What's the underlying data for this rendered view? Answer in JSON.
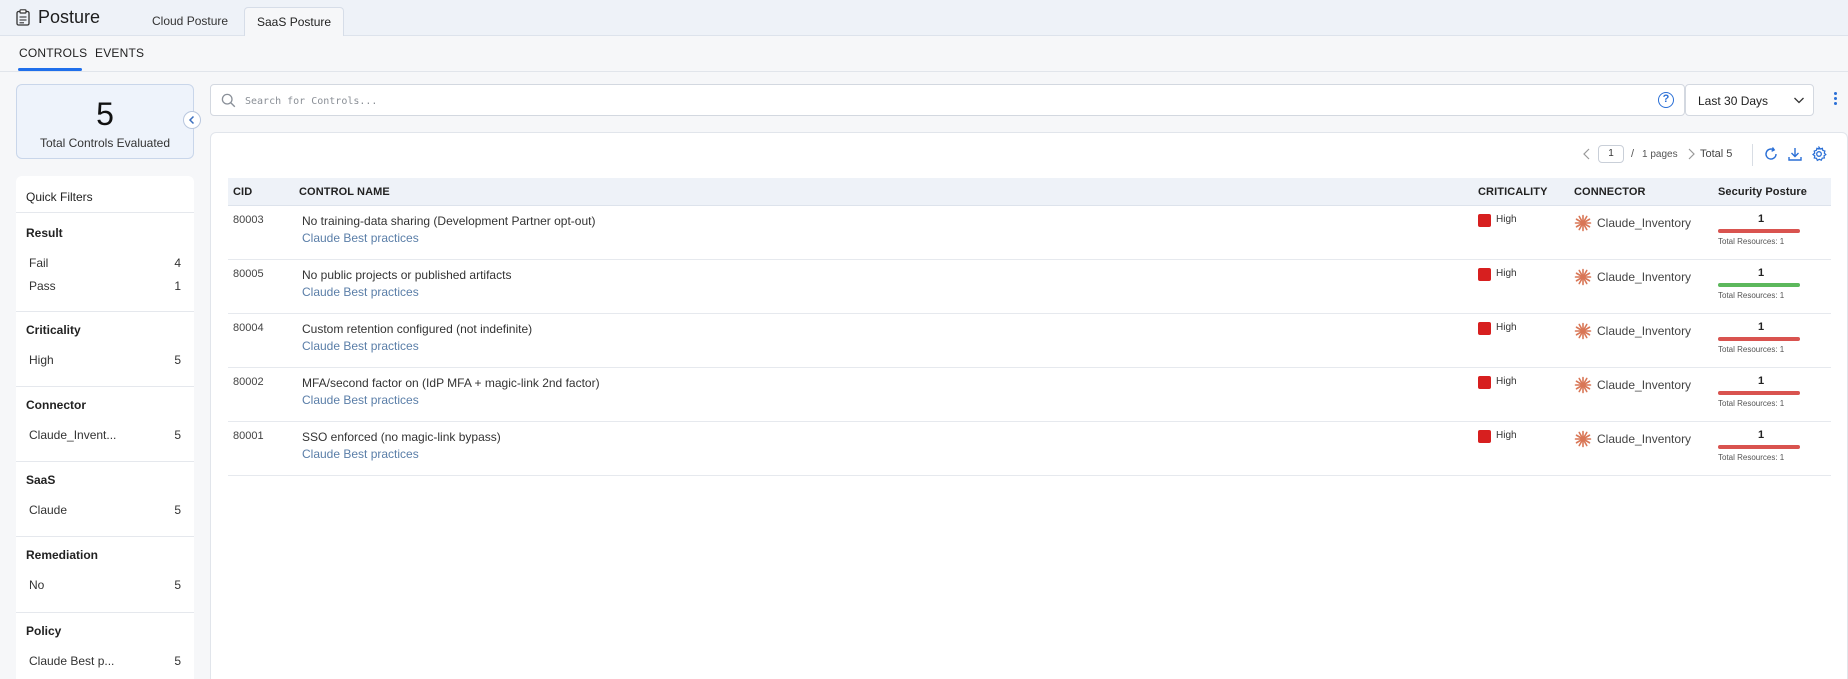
{
  "header": {
    "title": "Posture",
    "tabs": [
      {
        "label": "Cloud Posture"
      },
      {
        "label": "SaaS Posture"
      }
    ]
  },
  "subtabs": [
    {
      "label": "CONTROLS"
    },
    {
      "label": "EVENTS"
    }
  ],
  "summary": {
    "count": "5",
    "label": "Total Controls Evaluated"
  },
  "filters": {
    "title": "Quick Filters",
    "groups": [
      {
        "name": "Result",
        "items": [
          {
            "label": "Fail",
            "count": "4"
          },
          {
            "label": "Pass",
            "count": "1"
          }
        ]
      },
      {
        "name": "Criticality",
        "items": [
          {
            "label": "High",
            "count": "5"
          }
        ]
      },
      {
        "name": "Connector",
        "items": [
          {
            "label": "Claude_Invent...",
            "count": "5"
          }
        ]
      },
      {
        "name": "SaaS",
        "items": [
          {
            "label": "Claude",
            "count": "5"
          }
        ]
      },
      {
        "name": "Remediation",
        "items": [
          {
            "label": "No",
            "count": "5"
          }
        ]
      },
      {
        "name": "Policy",
        "items": [
          {
            "label": "Claude Best p...",
            "count": "5"
          }
        ]
      }
    ]
  },
  "search": {
    "placeholder": "Search for Controls...",
    "value": ""
  },
  "date_filter": {
    "value": "Last 30 Days"
  },
  "pagination": {
    "current_page": "1",
    "separator": "/",
    "total_pages": "1 pages",
    "total": "Total 5"
  },
  "table": {
    "columns": [
      "CID",
      "CONTROL NAME",
      "CRITICALITY",
      "CONNECTOR",
      "Security Posture"
    ],
    "rows": [
      {
        "cid": "80003",
        "name": "No training-data sharing (Development Partner opt-out)",
        "policy": "Claude Best practices",
        "criticality": "High",
        "connector": "Claude_Inventory",
        "posture": "1",
        "posture_status": "fail",
        "posture_level": 1.0,
        "total_resources": "Total Resources: 1"
      },
      {
        "cid": "80005",
        "name": "No public projects or published artifacts",
        "policy": "Claude Best practices",
        "criticality": "High",
        "connector": "Claude_Inventory",
        "posture": "1",
        "posture_status": "pass",
        "posture_level": 1.0,
        "total_resources": "Total Resources: 1"
      },
      {
        "cid": "80004",
        "name": "Custom retention configured (not indefinite)",
        "policy": "Claude Best practices",
        "criticality": "High",
        "connector": "Claude_Inventory",
        "posture": "1",
        "posture_status": "fail",
        "posture_level": 1.0,
        "total_resources": "Total Resources: 1"
      },
      {
        "cid": "80002",
        "name": "MFA/second factor on (IdP MFA + magic-link 2nd factor)",
        "policy": "Claude Best practices",
        "criticality": "High",
        "connector": "Claude_Inventory",
        "posture": "1",
        "posture_status": "fail",
        "posture_level": 1.0,
        "total_resources": "Total Resources: 1"
      },
      {
        "cid": "80001",
        "name": "SSO enforced (no magic-link bypass)",
        "policy": "Claude Best practices",
        "criticality": "High",
        "connector": "Claude_Inventory",
        "posture": "1",
        "posture_status": "fail",
        "posture_level": 1.0,
        "total_resources": "Total Resources: 1"
      }
    ]
  },
  "colors": {
    "accent": "#1f6feb",
    "high": "#d71f1f",
    "fail": "#d9534f",
    "pass": "#5cb85c",
    "policy_link": "#5a7ea8"
  },
  "icons": {
    "app": "clipboard-icon",
    "search": "search-icon",
    "help": "help-circle-icon",
    "dropdown": "chevron-down-icon",
    "more": "kebab-icon",
    "collapse": "chevron-left-icon",
    "refresh": "refresh-icon",
    "download": "download-icon",
    "settings": "gear-icon",
    "connector": "claude-logo-icon"
  }
}
